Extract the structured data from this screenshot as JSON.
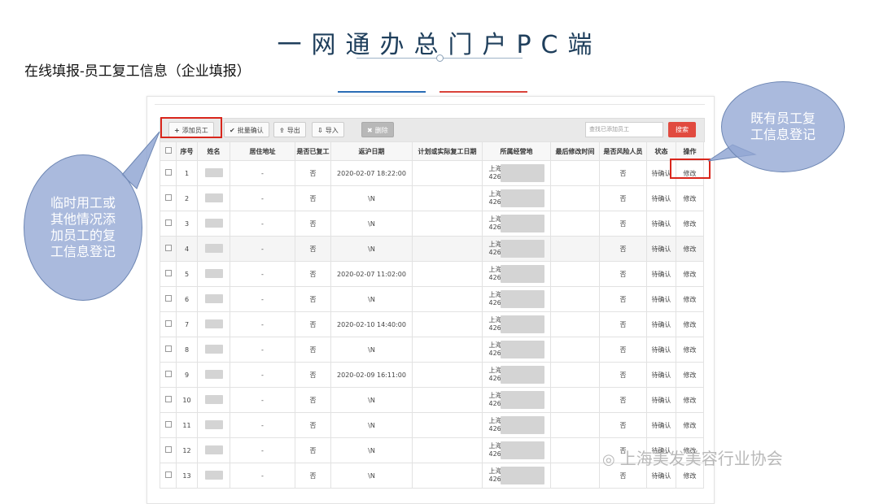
{
  "page": {
    "title": "一网通办总门户PC端",
    "subtitle": "在线填报-员工复工信息（企业填报）"
  },
  "toolbar": {
    "add_label": "添加员工",
    "batch_confirm_label": "批量确认",
    "export_label": "导出",
    "import_label": "导入",
    "delete_label": "删除",
    "search_placeholder": "查找已添加员工",
    "search_label": "搜索"
  },
  "table": {
    "headers": [
      "",
      "序号",
      "姓名",
      "居住地址",
      "是否已复工",
      "返沪日期",
      "计划或实际复工日期",
      "所属经营地",
      "最后修改时间",
      "是否风险人员",
      "状态",
      "操作"
    ],
    "rows": [
      {
        "no": "1",
        "address": "-",
        "resumed": "否",
        "return_date": "2020-02-07 18:22:00",
        "loc1": "上海",
        "loc2": "426",
        "risk": "否",
        "status": "待确认",
        "action": "修改"
      },
      {
        "no": "2",
        "address": "-",
        "resumed": "否",
        "return_date": "\\N",
        "loc1": "上海",
        "loc2": "426",
        "risk": "否",
        "status": "待确认",
        "action": "修改"
      },
      {
        "no": "3",
        "address": "-",
        "resumed": "否",
        "return_date": "\\N",
        "loc1": "上海",
        "loc2": "426",
        "risk": "否",
        "status": "待确认",
        "action": "修改"
      },
      {
        "no": "4",
        "address": "-",
        "resumed": "否",
        "return_date": "\\N",
        "loc1": "上海",
        "loc2": "426",
        "risk": "否",
        "status": "待确认",
        "action": "修改"
      },
      {
        "no": "5",
        "address": "-",
        "resumed": "否",
        "return_date": "2020-02-07 11:02:00",
        "loc1": "上海",
        "loc2": "426",
        "risk": "否",
        "status": "待确认",
        "action": "修改"
      },
      {
        "no": "6",
        "address": "-",
        "resumed": "否",
        "return_date": "\\N",
        "loc1": "上海",
        "loc2": "426",
        "risk": "否",
        "status": "待确认",
        "action": "修改"
      },
      {
        "no": "7",
        "address": "-",
        "resumed": "否",
        "return_date": "2020-02-10 14:40:00",
        "loc1": "上海",
        "loc2": "426",
        "risk": "否",
        "status": "待确认",
        "action": "修改"
      },
      {
        "no": "8",
        "address": "-",
        "resumed": "否",
        "return_date": "\\N",
        "loc1": "上海",
        "loc2": "426",
        "risk": "否",
        "status": "待确认",
        "action": "修改"
      },
      {
        "no": "9",
        "address": "-",
        "resumed": "否",
        "return_date": "2020-02-09 16:11:00",
        "loc1": "上海",
        "loc2": "426",
        "risk": "否",
        "status": "待确认",
        "action": "修改"
      },
      {
        "no": "10",
        "address": "-",
        "resumed": "否",
        "return_date": "\\N",
        "loc1": "上海",
        "loc2": "426",
        "risk": "否",
        "status": "待确认",
        "action": "修改"
      },
      {
        "no": "11",
        "address": "-",
        "resumed": "否",
        "return_date": "\\N",
        "loc1": "上海",
        "loc2": "426",
        "risk": "否",
        "status": "待确认",
        "action": "修改"
      },
      {
        "no": "12",
        "address": "-",
        "resumed": "否",
        "return_date": "\\N",
        "loc1": "上海",
        "loc2": "426",
        "risk": "否",
        "status": "待确认",
        "action": "修改"
      },
      {
        "no": "13",
        "address": "-",
        "resumed": "否",
        "return_date": "\\N",
        "loc1": "上海",
        "loc2": "426",
        "risk": "否",
        "status": "待确认",
        "action": "修改"
      }
    ]
  },
  "callouts": {
    "left": "临时用工或其他情况添加员工的复工信息登记",
    "right": "既有员工复工信息登记"
  },
  "watermark": {
    "text": "上海美发美容行业协会"
  },
  "colors": {
    "title": "#1f3f5c",
    "link": "#2d73c5",
    "highlight": "#d9261c",
    "search_button": "#e14a3f",
    "bubble": "#92a7d3"
  }
}
